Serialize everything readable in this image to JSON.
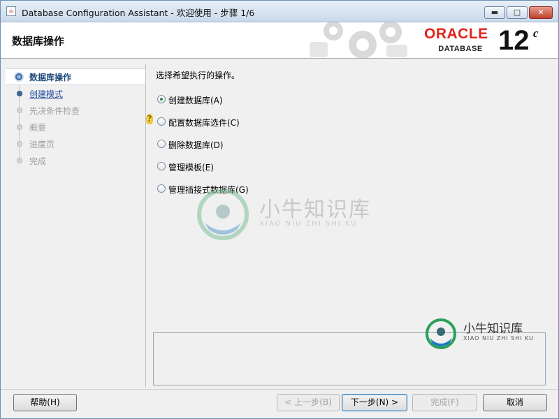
{
  "window": {
    "title": "Database Configuration Assistant - 欢迎使用 - 步骤 1/6",
    "minimize": "▬",
    "maximize": "□",
    "close": "✕"
  },
  "header": {
    "title": "数据库操作",
    "logo": {
      "brand": "ORACLE",
      "product": "DATABASE",
      "version": "12",
      "version_suffix": "c",
      "brand_color": "#e2231a"
    }
  },
  "sidebar": {
    "steps": [
      {
        "label": "数据库操作",
        "state": "current"
      },
      {
        "label": "创建模式",
        "state": "next"
      },
      {
        "label": "先决条件检查",
        "state": "disabled"
      },
      {
        "label": "概要",
        "state": "disabled"
      },
      {
        "label": "进度页",
        "state": "disabled"
      },
      {
        "label": "完成",
        "state": "disabled"
      }
    ]
  },
  "main": {
    "prompt": "选择希望执行的操作。",
    "options": [
      {
        "label": "创建数据库(A)",
        "checked": true
      },
      {
        "label": "配置数据库选件(C)",
        "checked": false
      },
      {
        "label": "删除数据库(D)",
        "checked": false
      },
      {
        "label": "管理模板(E)",
        "checked": false
      },
      {
        "label": "管理插接式数据库(G)",
        "checked": false
      }
    ],
    "hint_icon": "?"
  },
  "watermark": {
    "text": "小牛知识库",
    "sub": "XIAO NIU ZHI SHI KU"
  },
  "footer": {
    "help": "帮助(H)",
    "back": "< 上一步(B)",
    "next": "下一步(N) >",
    "finish": "完成(F)",
    "cancel": "取消"
  }
}
